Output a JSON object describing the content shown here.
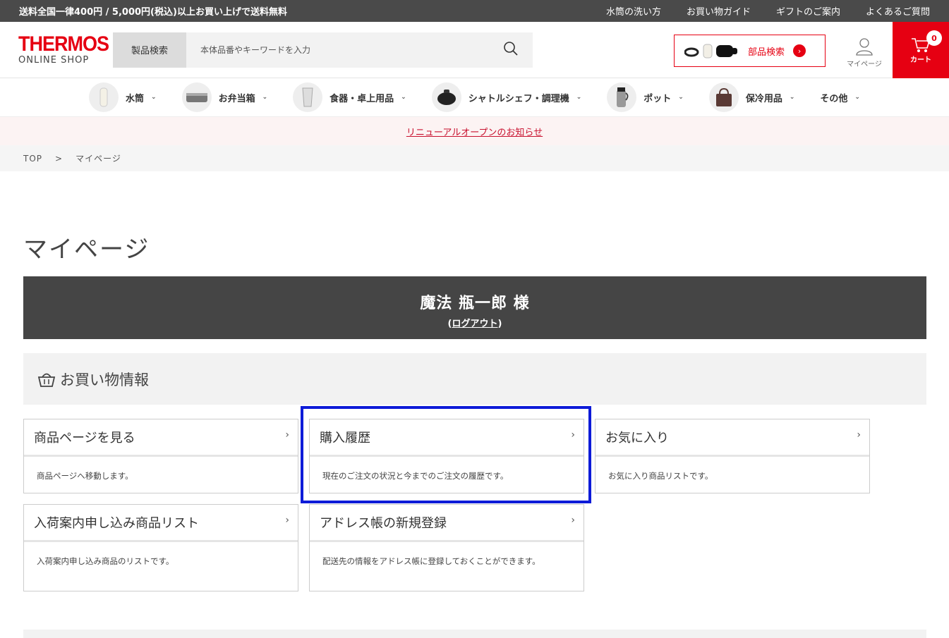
{
  "topbar": {
    "promo": "送料全国一律400円 / 5,000円(税込)以上お買い上げで送料無料",
    "links": [
      "水筒の洗い方",
      "お買い物ガイド",
      "ギフトのご案内",
      "よくあるご質問"
    ]
  },
  "header": {
    "logo_brand": "THERMOS",
    "logo_sub": "ONLINE SHOP",
    "search_label": "製品検索",
    "search_placeholder": "本体品番やキーワードを入力",
    "parts_label": "部品検索",
    "mypage_label": "マイページ",
    "cart_label": "カート",
    "cart_count": "0"
  },
  "categories": [
    {
      "label": "水筒",
      "icon": "bottle-icon"
    },
    {
      "label": "お弁当箱",
      "icon": "lunchbox-icon"
    },
    {
      "label": "食器・卓上用品",
      "icon": "tumbler-icon"
    },
    {
      "label": "シャトルシェフ・調理機",
      "icon": "pot-icon"
    },
    {
      "label": "ポット",
      "icon": "jug-icon"
    },
    {
      "label": "保冷用品",
      "icon": "bag-icon"
    },
    {
      "label": "その他",
      "icon": ""
    }
  ],
  "notice": "リニューアルオープンのお知らせ",
  "breadcrumb": {
    "top": "TOP",
    "sep": ">",
    "current": "マイページ"
  },
  "page_title": "マイページ",
  "user": {
    "name": "魔法 瓶一郎 様",
    "logout": "ログアウト"
  },
  "section_title": "お買い物情報",
  "cards": [
    {
      "title": "商品ページを見る",
      "desc": "商品ページへ移動します。"
    },
    {
      "title": "購入履歴",
      "desc": "現在のご注文の状況と今までのご注文の履歴です。"
    },
    {
      "title": "お気に入り",
      "desc": "お気に入り商品リストです。"
    },
    {
      "title": "入荷案内申し込み商品リスト",
      "desc": "入荷案内申し込み商品のリストです。"
    },
    {
      "title": "アドレス帳の新規登録",
      "desc": "配送先の情報をアドレス帳に登録しておくことができます。"
    }
  ],
  "colors": {
    "brand": "#e60012",
    "highlight": "#0d1bd8"
  }
}
